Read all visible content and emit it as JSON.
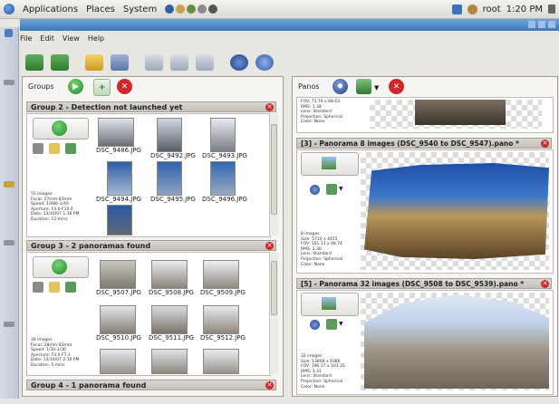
{
  "topbar": {
    "menus": [
      "Applications",
      "Places",
      "System"
    ],
    "user": "root",
    "clock": "1:20 PM"
  },
  "appmenu": [
    "File",
    "Edit",
    "View",
    "Help"
  ],
  "groups_panel": {
    "title": "Groups",
    "groups": [
      {
        "header": "Group 2 - Detection not launched yet",
        "info": "55 images\nFocal: 27mm-83mm\nSpeed: 1/986-1/40\nAperture: F4.6-F10.0\nDate: 13/10/07 1:36 PM\nDuration: 12 mins",
        "thumbs": [
          "DSC_9486.JPG",
          "DSC_9492.JPG",
          "DSC_9493.JPG",
          "DSC_9494.JPG",
          "DSC_9495.JPG",
          "DSC_9496.JPG",
          ""
        ]
      },
      {
        "header": "Group 3 - 2 panoramas found",
        "info": "38 images\nFocal: 28mm-83mm\nSpeed: 1/30-1/30\nAperture: F4.0-F7.1\nDate: 13/10/07 2:10 PM\nDuration: 5 mins",
        "thumbs": [
          "DSC_9507.JPG",
          "DSC_9508.JPG",
          "DSC_9509.JPG",
          "DSC_9510.JPG",
          "DSC_9511.JPG",
          "DSC_9512.JPG"
        ]
      },
      {
        "header": "Group 4 - 1 panorama found"
      }
    ]
  },
  "panos_panel": {
    "title": "Panos",
    "top_info": "FOV: 73.79 x 68.63\nRMS: 1.38\nLens: Standard\nProjection: Spherical\nColor: None",
    "panos": [
      {
        "header": "[3] - Panorama 8 images (DSC_9540 to DSC_9547).pano *",
        "info": "8 images\nSize: 5710 x 4455\nFOV: 101.13 x 98.74\nRMS: 2.36\nLens: Standard\nProjection: Spherical\nColor: None"
      },
      {
        "header": "[5] - Panorama 32 images (DSC_9508 to DSC_9539).pano *",
        "info": "32 images\nSize: 13808 x 9386\nFOV: 196.17 x 103.35\nRMS: 3.31\nLens: Standard\nProjection: Spherical\nColor: None"
      }
    ]
  },
  "colors": {
    "accent_blue": "#3d78bd",
    "close_red": "#d3262a",
    "play_green": "#1d8c25"
  }
}
